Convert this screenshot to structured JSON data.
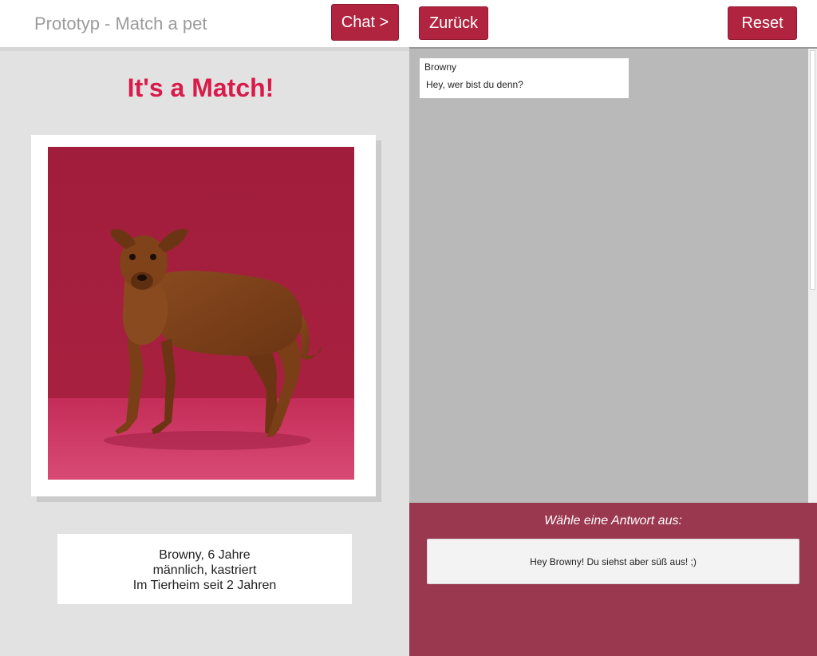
{
  "header": {
    "app_title": "Prototyp - Match a pet",
    "chat_button": "Chat >"
  },
  "match": {
    "title": "It's a Match!",
    "photo_icon": "dog-photo",
    "info": [
      "Browny, 6 Jahre",
      "männlich, kastriert",
      "Im Tierheim seit 2 Jahren"
    ]
  },
  "chat": {
    "back_button": "Zurück",
    "reset_button": "Reset",
    "messages": [
      {
        "sender": "Browny",
        "text": "Hey, wer bist du denn?"
      }
    ],
    "answer_prompt": "Wähle eine Antwort aus:",
    "answer_options": [
      "Hey Browny! Du siehst aber süß aus! ;)"
    ]
  },
  "colors": {
    "accent": "#b0243f",
    "match_title": "#d81b4a",
    "answer_panel": "#9a384f",
    "chat_background": "#b9b9b9",
    "left_background": "#e2e2e2"
  }
}
